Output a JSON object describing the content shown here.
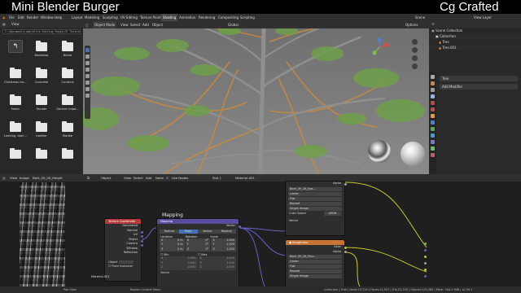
{
  "banner": {
    "left_title": "Mini Blender Burger",
    "right_title": "Cg Crafted"
  },
  "colors": {
    "accent": "#4772b3",
    "node_header_input": "#b53a3a",
    "node_header_vector": "#5a4b9c",
    "node_header_texture": "#c97435",
    "background": "#1d1d1d"
  },
  "topbar": {
    "menus": [
      "File",
      "Edit",
      "Render",
      "Window",
      "Help"
    ],
    "workspaces": [
      "Layout",
      "Modeling",
      "Sculpting",
      "UV Editing",
      "Texture Paint",
      "Shading",
      "Animation",
      "Rendering",
      "Compositing",
      "Scripting"
    ],
    "active_workspace": "Shading",
    "scene": "Scene",
    "view_layer": "View Layer"
  },
  "file_browser": {
    "view_label": "View",
    "path": "C:\\Documents\\ume\\Ultra Editing Packs\\CG Textures\\",
    "items": [
      {
        "label": "",
        "icon": "parent-folder-icon"
      },
      {
        "label": "Backdrop",
        "icon": "folder-icon"
      },
      {
        "label": "Bricks",
        "icon": "folder-icon"
      },
      {
        "label": "Christmas tre...",
        "icon": "folder-icon"
      },
      {
        "label": "Concrete",
        "icon": "folder-icon"
      },
      {
        "label": "Curtains",
        "icon": "folder-icon"
      },
      {
        "label": "Fabric",
        "icon": "folder-icon"
      },
      {
        "label": "Facade",
        "icon": "folder-icon"
      },
      {
        "label": "Generic impe...",
        "icon": "folder-icon"
      },
      {
        "label": "Leaking, dam...",
        "icon": "folder-icon"
      },
      {
        "label": "Leather",
        "icon": "folder-icon"
      },
      {
        "label": "Marble",
        "icon": "folder-icon"
      },
      {
        "label": "",
        "icon": "folder-icon"
      },
      {
        "label": "",
        "icon": "folder-icon"
      },
      {
        "label": "",
        "icon": "folder-icon"
      }
    ]
  },
  "viewport": {
    "mode": "Object Mode",
    "menus": [
      "View",
      "Select",
      "Add",
      "Object"
    ],
    "orientation": "Global",
    "options_label": "Options"
  },
  "outliner": {
    "title": "Scene Collection",
    "rows": [
      "Collection",
      "Tree",
      "Tree.001"
    ]
  },
  "properties": {
    "object_name": "Tree",
    "add_modifier": "Add Modifier"
  },
  "image_editor": {
    "menus": [
      "View",
      "Image"
    ],
    "image_name": "Bark_09_2K_Height"
  },
  "node_editor": {
    "object_type": "Object",
    "menus": [
      "View",
      "Select",
      "Add",
      "Node"
    ],
    "use_nodes": "Use Nodes",
    "slot": "Slot 1",
    "material": "Material.001",
    "frame_label": "Mapping",
    "material_label": "Material.001",
    "texcoord": {
      "title": "Texture Coordinate",
      "outputs": [
        "Generated",
        "Normal",
        "UV",
        "Object",
        "Camera",
        "Window",
        "Reflection"
      ],
      "object_label": "Object",
      "from_instancer": "From Instancer"
    },
    "mapping": {
      "title": "Mapping",
      "output": "Vector",
      "types": [
        "Texture",
        "Point",
        "Vector",
        "Normal"
      ],
      "active_type": "Point",
      "columns": [
        "Location",
        "Rotation",
        "Scale"
      ],
      "rows": [
        {
          "axis": "X",
          "loc": "0 m",
          "rot": "0°",
          "scale": "1.000"
        },
        {
          "axis": "Y",
          "loc": "0 m",
          "rot": "0°",
          "scale": "1.000"
        },
        {
          "axis": "Z",
          "loc": "0 m",
          "rot": "0°",
          "scale": "1.000"
        }
      ],
      "min_label": "Min",
      "max_label": "Max",
      "minmax_rows": [
        {
          "axis": "X",
          "min": "0.000",
          "max": "1.000"
        },
        {
          "axis": "Y",
          "min": "0.000",
          "max": "1.000"
        },
        {
          "axis": "Z",
          "min": "0.000",
          "max": "1.000"
        }
      ],
      "input": "Vector"
    },
    "tex_top": {
      "output_alpha": "Alpha",
      "image": "Bark_09_2K_Bas...",
      "interp": "Linear",
      "proj": "Flat",
      "ext": "Repeat",
      "source": "Single Image",
      "cs_label": "Color Space",
      "cs_value": "sRGB",
      "input": "Vector"
    },
    "tex_bottom": {
      "title": "Roughness",
      "out_color": "Color",
      "out_alpha": "Alpha",
      "image": "Bark_09_2K_Rou...",
      "interp": "Linear",
      "proj": "Flat",
      "ext": "Repeat",
      "source": "Single Image"
    }
  },
  "status": {
    "left": "Pan View",
    "mid": "Region Context Menu",
    "right": "Collection | Tree | Verts:23,714 | Faces:13,557 | Tris:22,235 | Objects:1/3,065 | Mem: 344.2 MiB | v2.90.1"
  }
}
